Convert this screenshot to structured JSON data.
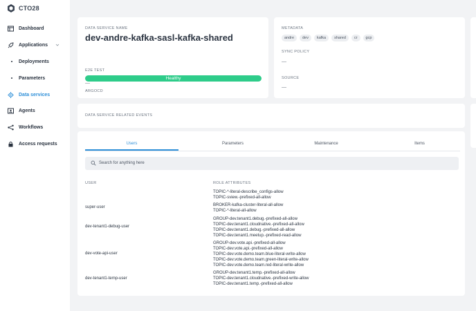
{
  "brand": {
    "logo_text": "CTO28"
  },
  "sidebar": {
    "items": [
      {
        "label": "Dashboard",
        "icon": "dashboard-icon"
      },
      {
        "label": "Applications",
        "icon": "rocket-icon"
      },
      {
        "label": "Deployments",
        "icon": "dot-icon"
      },
      {
        "label": "Parameters",
        "icon": "dot-icon"
      },
      {
        "label": "Data services",
        "icon": "gear-icon"
      },
      {
        "label": "Agents",
        "icon": "agent-icon"
      },
      {
        "label": "Workflows",
        "icon": "workflow-icon"
      },
      {
        "label": "Access requests",
        "icon": "lock-icon"
      }
    ],
    "active_index": 4,
    "accent_color": "#2e8fd8"
  },
  "service": {
    "name_label": "DATA SERVICE NAME",
    "name": "dev-andre-kafka-sasl-kafka-shared",
    "e2e_label": "E2E TEST",
    "health": "Healthy",
    "health_color": "#2ecc8a",
    "argocd_label": "ARGOCD",
    "argocd_value": "—"
  },
  "metadata": {
    "label": "METADATA",
    "tags": [
      "andre",
      "dev",
      "kafka",
      "shared",
      "cr",
      "gcp"
    ],
    "sync_label": "SYNC POLICY",
    "sync_value": "—",
    "source_label": "SOURCE",
    "source_value": "—"
  },
  "events": {
    "label": "DATA SERVICE RELATED EVENTS"
  },
  "tabs": {
    "items": [
      "Users",
      "Parameters",
      "Maintenance",
      "Items"
    ],
    "active_index": 0
  },
  "search": {
    "placeholder": "Search for anything here"
  },
  "table": {
    "headers": [
      "USER",
      "ROLE ATTRIBUTES"
    ],
    "rows": [
      {
        "user": "",
        "attributes": [
          "TOPIC-*-literal-describe_configs-allow",
          "TOPIC-sview.-prefixed-all-allow"
        ]
      },
      {
        "user": "super-user",
        "attributes": [
          "BROKER-kafka-cluster-literal-all-allow",
          "TOPIC-*-literal-all-allow"
        ]
      },
      {
        "user": "dev-tenant1-debug-user",
        "attributes": [
          "GROUP-dev.tenant1.debug.-prefixed-all-allow",
          "TOPIC-dev.tenant1.cloudnative.-prefixed-all-allow",
          "TOPIC-dev.tenant1.debug.-prefixed-all-allow",
          "TOPIC-dev.tenant1.meetup.-prefixed-read-allow"
        ]
      },
      {
        "user": "dev-vote-api-user",
        "attributes": [
          "GROUP-dev.vote.api.-prefixed-all-allow",
          "TOPIC-dev.vote.api.-prefixed-all-allow",
          "TOPIC-dev.vote.demo.team.blue-literal-write-allow",
          "TOPIC-dev.vote.demo.team.green-literal-write-allow",
          "TOPIC-dev.vote.demo.team.red-literal-write-allow"
        ]
      },
      {
        "user": "dev-tenant1-temp-user",
        "attributes": [
          "GROUP-dev.tenant1.temp.-prefixed-all-allow",
          "TOPIC-dev.tenant1.cloudnative.-prefixed-write-allow",
          "TOPIC-dev.tenant1.temp.-prefixed-all-allow"
        ]
      }
    ]
  }
}
